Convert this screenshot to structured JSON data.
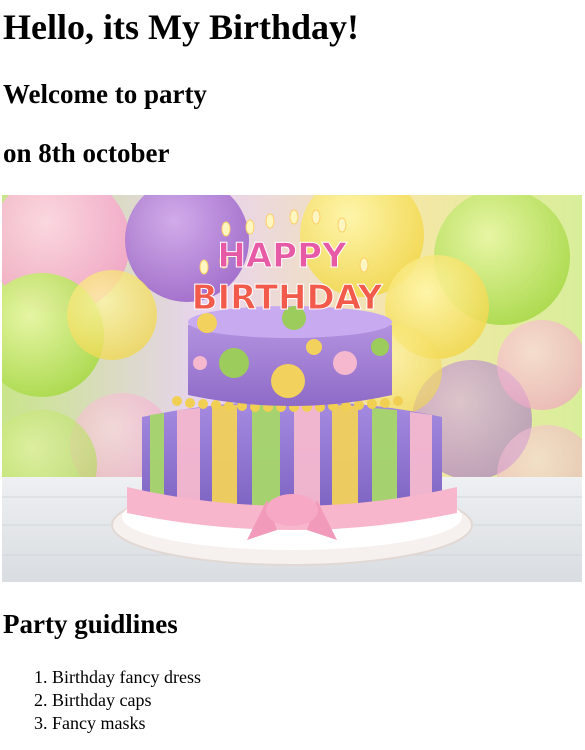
{
  "page": {
    "heading": "Hello, its My Birthday!",
    "welcome": "Welcome to party",
    "date_line": "on 8th october",
    "image": {
      "alt": "Birthday cake",
      "topper_line_1": "HAPPY",
      "topper_line_2": "BIRTHDAY"
    },
    "guidelines": {
      "title": "Party guidlines",
      "items": [
        "Birthday fancy dress",
        "Birthday caps",
        "Fancy masks"
      ]
    }
  },
  "colors": {
    "text": "#000000",
    "background": "#ffffff"
  }
}
